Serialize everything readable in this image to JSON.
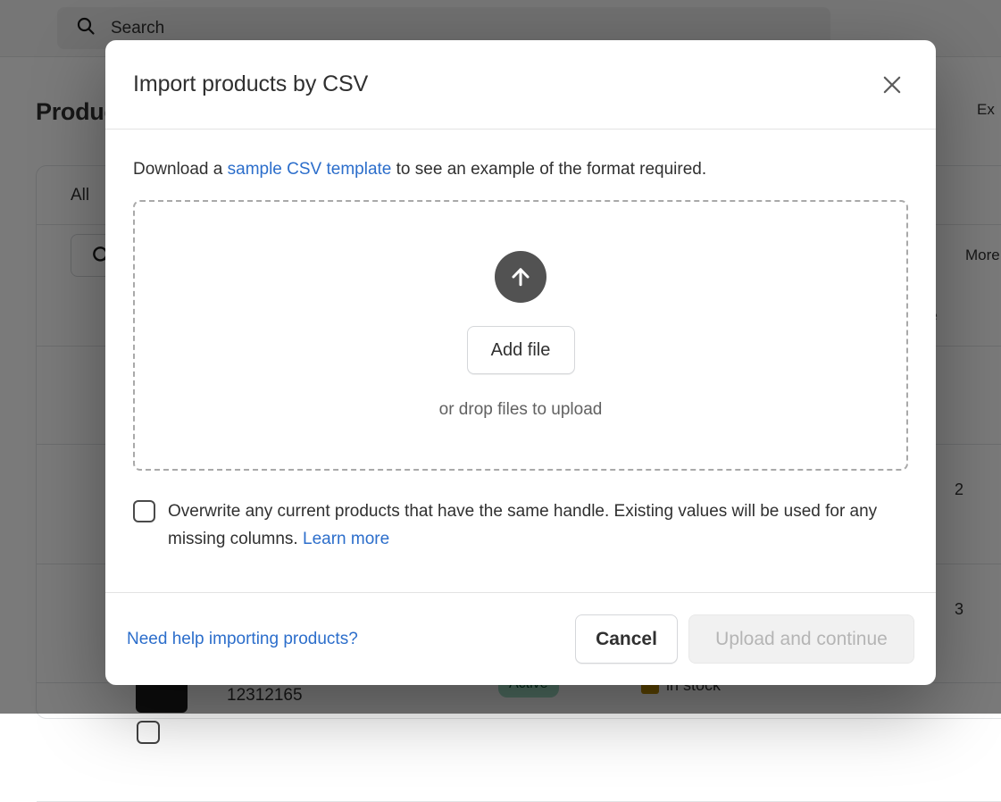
{
  "background": {
    "search": {
      "placeholder": "Search",
      "icon": "search-icon"
    },
    "page_title": "Products",
    "export_label": "Ex",
    "tab_all": "All",
    "more_filters_label": "More filt",
    "column_type": "pe",
    "row_numbers": [
      "2",
      "3"
    ],
    "product_sku": "12312165",
    "status_badge": "Active",
    "stock_label": "in stock",
    "stock_count": "2"
  },
  "modal": {
    "title": "Import products by CSV",
    "close_icon": "close-icon",
    "intro_prefix": "Download a ",
    "intro_link": "sample CSV template",
    "intro_suffix": " to see an example of the format required.",
    "dropzone": {
      "upload_icon": "upload-arrow-icon",
      "add_file_label": "Add file",
      "drop_hint": "or drop files to upload"
    },
    "overwrite": {
      "checked": false,
      "text": "Overwrite any current products that have the same handle. Existing values will be used for any missing columns. ",
      "learn_more": "Learn more"
    },
    "footer": {
      "help_link": "Need help importing products?",
      "cancel_label": "Cancel",
      "upload_label": "Upload and continue",
      "upload_disabled": true
    }
  },
  "colors": {
    "link": "#2c6ecb",
    "accent_green": "#0b6b4f",
    "badge_active_bg": "#a0ddc5",
    "badge_active_text": "#0c5132",
    "stock_warning": "#b98900",
    "upload_circle": "#525252"
  }
}
